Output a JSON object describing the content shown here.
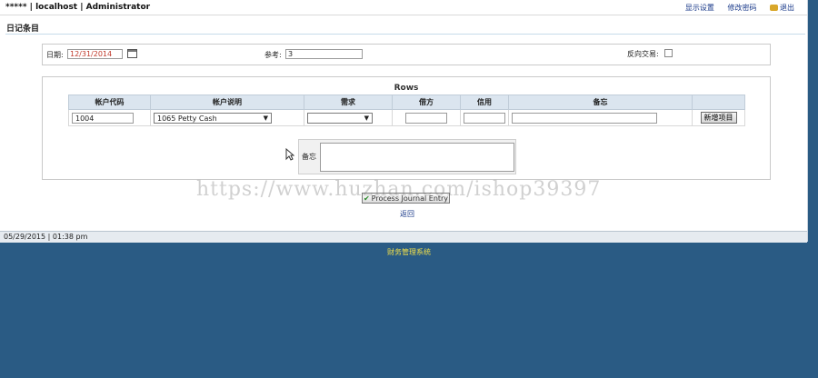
{
  "header": {
    "title": "***** | localhost | Administrator",
    "links": [
      "显示设置",
      "修改密码",
      "退出"
    ]
  },
  "section_title": "日记条目",
  "form": {
    "date_label": "日期:",
    "date_value": "12/31/2014",
    "reference_label": "参考:",
    "reference_value": "3",
    "reverse_label": "反向交易:"
  },
  "rows": {
    "title": "Rows",
    "columns": [
      "帐户代码",
      "帐户说明",
      "需求",
      "借方",
      "信用",
      "备忘",
      ""
    ],
    "row": {
      "account_code": "1004",
      "account_desc": "1065    Petty Cash",
      "demand": "",
      "debit": "",
      "credit": "",
      "memo": "",
      "add_button": "新增项目"
    }
  },
  "memo_label": "备忘",
  "submit_button": "Process Journal Entry",
  "back_link": "返回",
  "watermark": "https://www.huzhan.com/ishop39397",
  "status": "05/29/2015 | 01:38 pm",
  "footer": "财务管理系统",
  "colors": {
    "background": "#2a5b84",
    "header_cell": "#dbe5ef",
    "link": "#1a3a8a",
    "footer_text": "#f2e04a",
    "date_text": "#c0392b"
  },
  "icons": [
    "calendar-icon",
    "key-icon",
    "checkmark-icon",
    "pointer-cursor-icon",
    "dropdown-caret-icon"
  ]
}
